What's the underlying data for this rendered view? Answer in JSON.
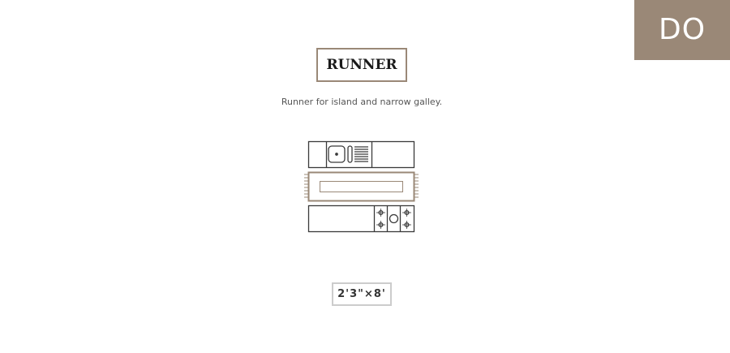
{
  "badge": {
    "text": "DO"
  },
  "header": {
    "title": "RUNNER",
    "description": "Runner for island and narrow galley."
  },
  "dimension": {
    "label": "2'3\"×8'"
  },
  "icons": {
    "top_counter": "sink-counter-icon",
    "rug": "runner-rug-icon",
    "bottom_counter": "cooktop-counter-icon"
  },
  "colors": {
    "accent": "#9a8877",
    "line": "#3a3a3a",
    "rug_border": "#9a8877",
    "size_border": "#cccccc"
  }
}
